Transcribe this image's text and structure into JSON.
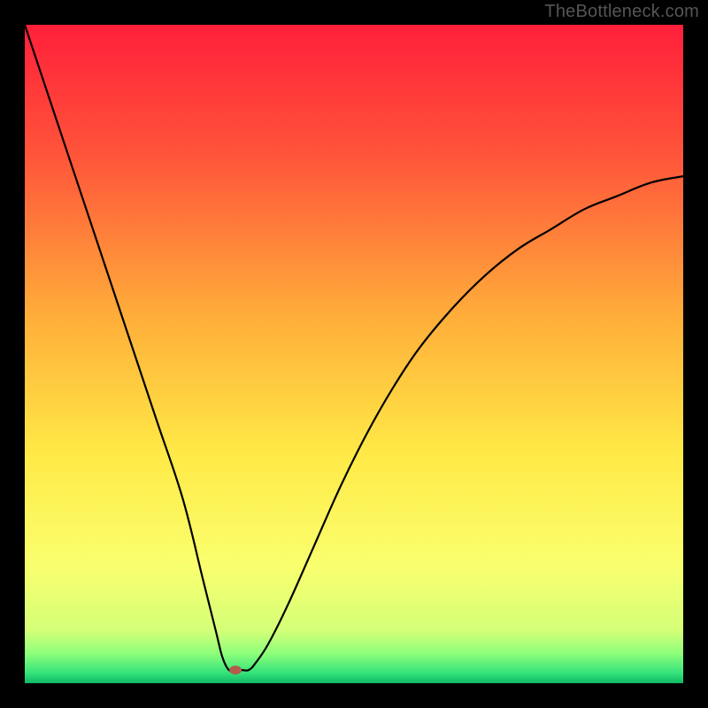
{
  "watermark": "TheBottleneck.com",
  "chart_data": {
    "type": "line",
    "title": "",
    "xlabel": "",
    "ylabel": "",
    "xlim": [
      0,
      100
    ],
    "ylim": [
      0,
      100
    ],
    "watermark": "TheBottleneck.com",
    "marker": {
      "x": 32,
      "y": 2,
      "color": "#b35c4a"
    },
    "gradient_stops": [
      {
        "offset": 0.0,
        "color": "#ff1f3a"
      },
      {
        "offset": 0.2,
        "color": "#ff553a"
      },
      {
        "offset": 0.45,
        "color": "#ffb03a"
      },
      {
        "offset": 0.65,
        "color": "#ffe946"
      },
      {
        "offset": 0.82,
        "color": "#faff6e"
      },
      {
        "offset": 0.92,
        "color": "#d4ff78"
      },
      {
        "offset": 0.955,
        "color": "#8dff7a"
      },
      {
        "offset": 0.985,
        "color": "#33e27a"
      },
      {
        "offset": 1.0,
        "color": "#0fb864"
      }
    ],
    "series": [
      {
        "name": "curve",
        "x": [
          0,
          4,
          8,
          12,
          16,
          20,
          24,
          27,
          29,
          30,
          31,
          32,
          33,
          34,
          35,
          37,
          40,
          44,
          48,
          52,
          56,
          60,
          65,
          70,
          75,
          80,
          85,
          90,
          95,
          100
        ],
        "y": [
          100,
          88,
          76,
          64,
          52,
          40,
          28,
          16,
          8,
          4,
          2,
          2,
          2,
          2,
          3,
          6,
          12,
          21,
          30,
          38,
          45,
          51,
          57,
          62,
          66,
          69,
          72,
          74,
          76,
          77
        ]
      }
    ]
  }
}
